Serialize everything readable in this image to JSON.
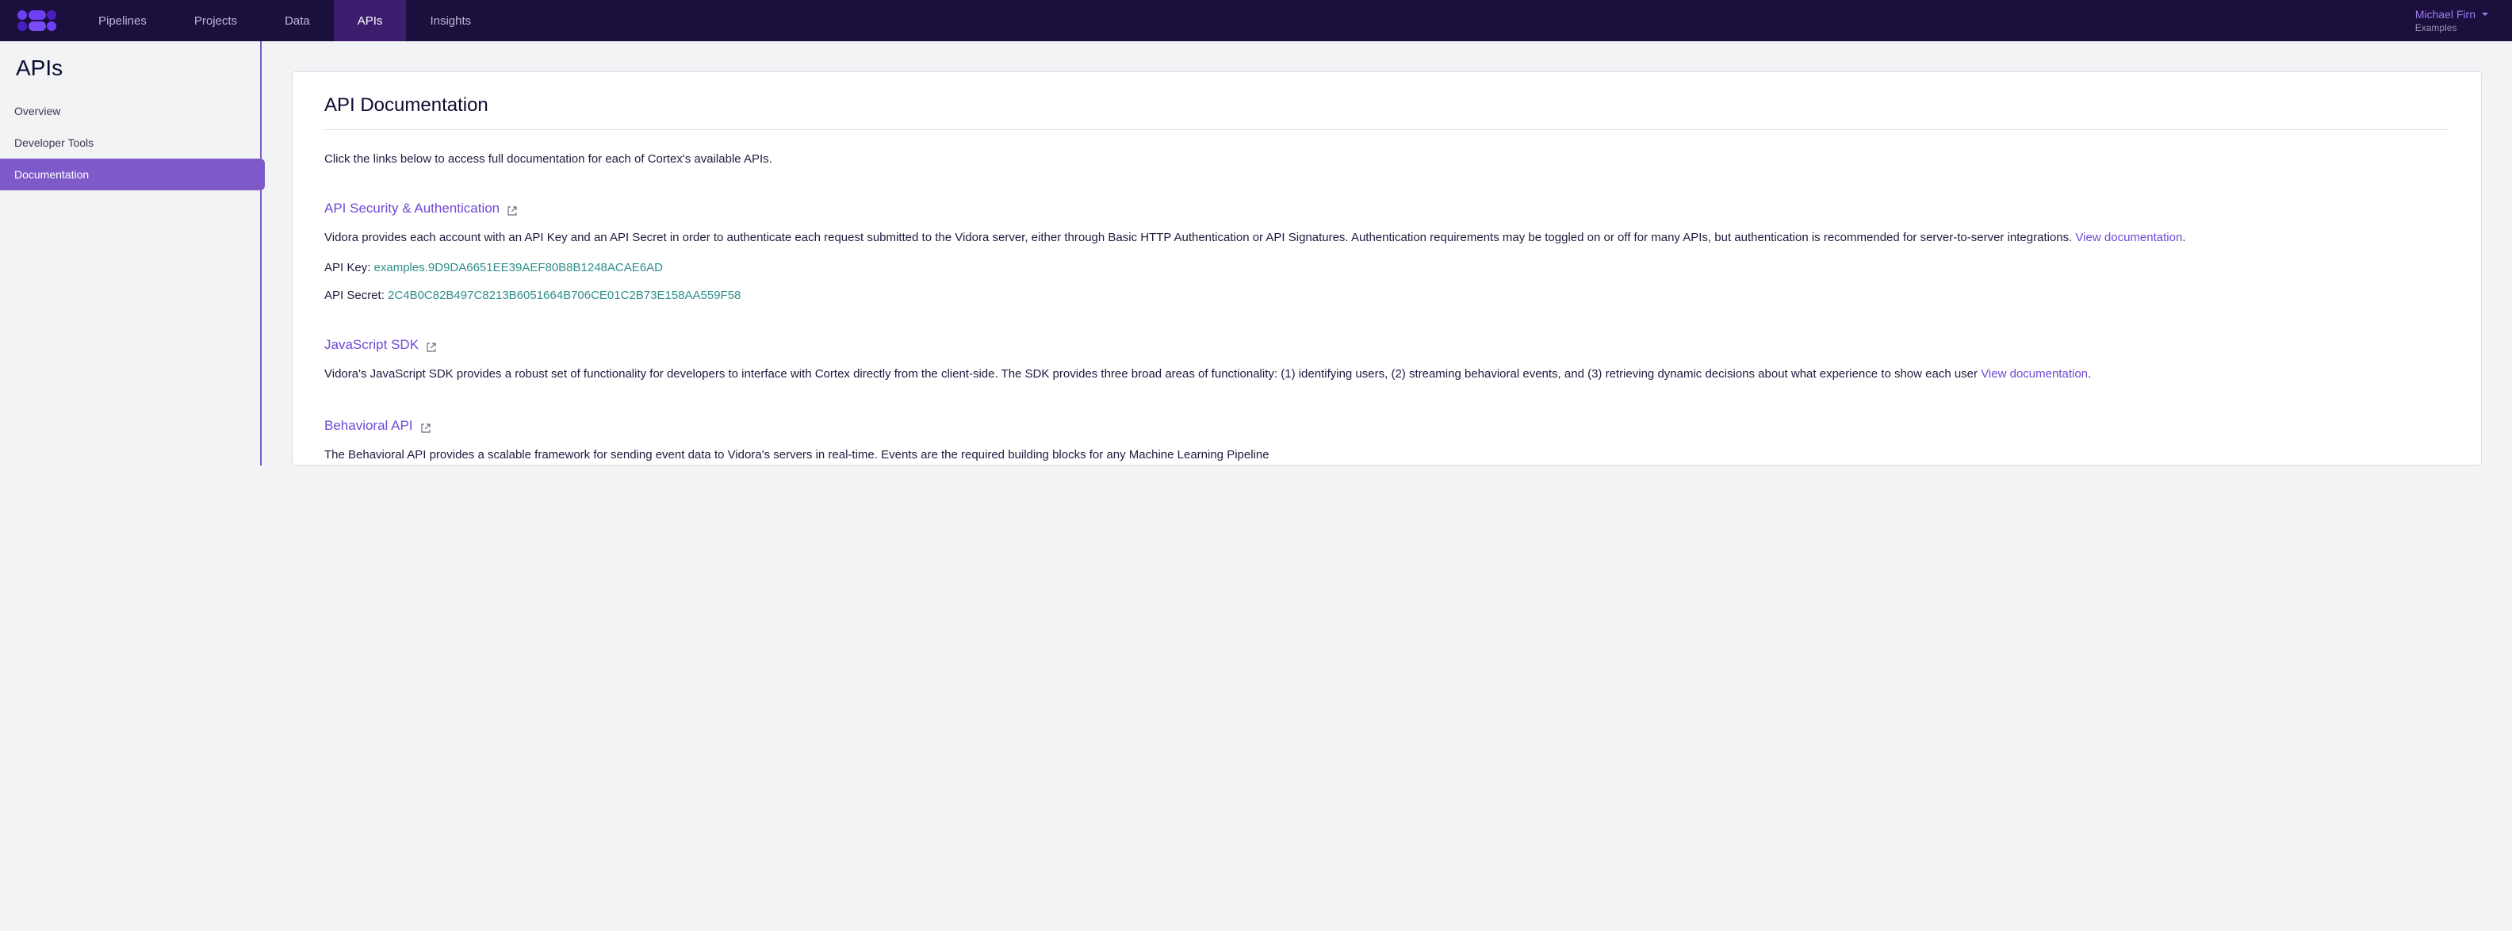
{
  "nav": {
    "items": [
      {
        "label": "Pipelines"
      },
      {
        "label": "Projects"
      },
      {
        "label": "Data"
      },
      {
        "label": "APIs"
      },
      {
        "label": "Insights"
      }
    ]
  },
  "user": {
    "name": "Michael Firn",
    "sub": "Examples"
  },
  "sidebar": {
    "title": "APIs",
    "items": [
      {
        "label": "Overview"
      },
      {
        "label": "Developer Tools"
      },
      {
        "label": "Documentation"
      }
    ]
  },
  "page": {
    "title": "API Documentation",
    "intro": "Click the links below to access full documentation for each of Cortex's available APIs.",
    "sections": [
      {
        "title": "API Security & Authentication",
        "body": "Vidora provides each account with an API Key and an API Secret in order to authenticate each request submitted to the Vidora server, either through Basic HTTP Authentication or API Signatures. Authentication requirements may be toggled on or off for many APIs, but authentication is recommended for server-to-server integrations. ",
        "link_text": "View documentation",
        "trailing": ".",
        "api_key_label": "API Key: ",
        "api_key_value": "examples.9D9DA6651EE39AEF80B8B1248ACAE6AD",
        "api_secret_label": "API Secret: ",
        "api_secret_value": "2C4B0C82B497C8213B6051664B706CE01C2B73E158AA559F58"
      },
      {
        "title": "JavaScript SDK",
        "body": "Vidora's JavaScript SDK provides a robust set of functionality for developers to interface with Cortex directly from the client-side. The SDK provides three broad areas of functionality: (1) identifying users, (2) streaming behavioral events, and (3) retrieving dynamic decisions about what experience to show each user ",
        "link_text": "View documentation",
        "trailing": "."
      },
      {
        "title": "Behavioral API",
        "body": "The Behavioral API provides a scalable framework for sending event data to Vidora's servers in real-time. Events are the required building blocks for any Machine Learning Pipeline"
      }
    ]
  }
}
